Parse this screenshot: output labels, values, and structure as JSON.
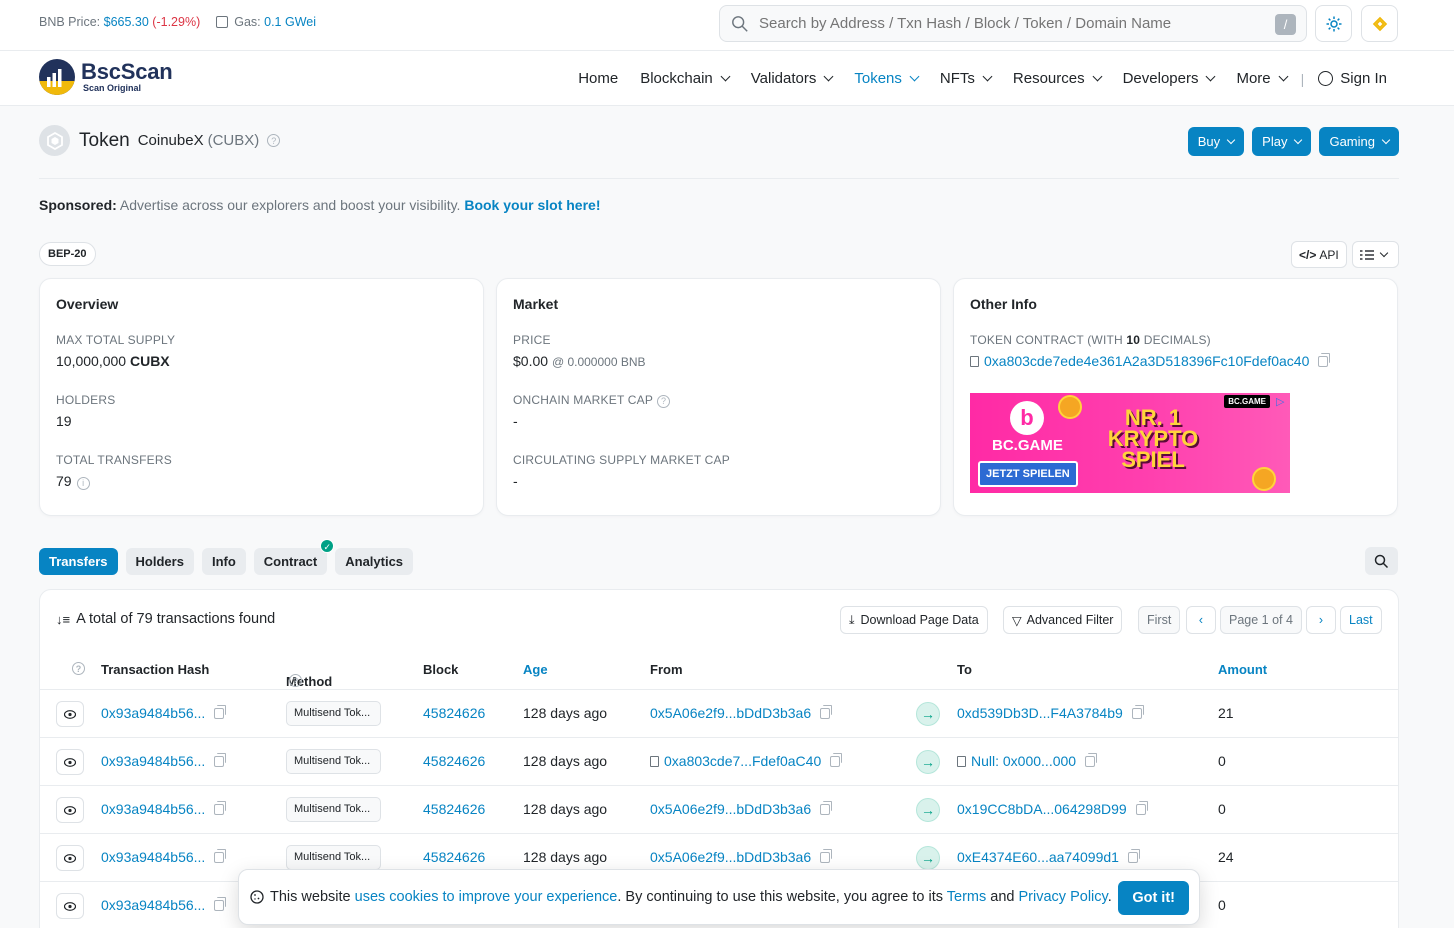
{
  "topbar": {
    "bnb_label": "BNB Price:",
    "bnb_price": "$665.30",
    "bnb_change": "(-1.29%)",
    "gas_label": "Gas:",
    "gas_value": "0.1 GWei",
    "search_placeholder": "Search by Address / Txn Hash / Block / Token / Domain Name",
    "search_shortcut": "/"
  },
  "nav": {
    "brand": "BscScan",
    "tagline": "Scan Original",
    "items": [
      "Home",
      "Blockchain",
      "Validators",
      "Tokens",
      "NFTs",
      "Resources",
      "Developers",
      "More"
    ],
    "separator": "|",
    "signin": "Sign In"
  },
  "token": {
    "label": "Token",
    "name": "CoinubeX",
    "symbol": "(CUBX)",
    "buttons": [
      "Buy",
      "Play",
      "Gaming"
    ]
  },
  "sponsor": {
    "label": "Sponsored:",
    "text": " Advertise across our explorers and boost your visibility. ",
    "link": "Book your slot here!"
  },
  "standard": "BEP-20",
  "api_label": "API",
  "overview": {
    "title": "Overview",
    "max_supply_label": "MAX TOTAL SUPPLY",
    "max_supply_value": "10,000,000",
    "max_supply_unit": "CUBX",
    "holders_label": "HOLDERS",
    "holders_value": "19",
    "transfers_label": "TOTAL TRANSFERS",
    "transfers_value": "79"
  },
  "market": {
    "title": "Market",
    "price_label": "PRICE",
    "price_value": "$0.00",
    "price_bnb": "@ 0.000000 BNB",
    "onchain_label": "ONCHAIN MARKET CAP",
    "onchain_value": "-",
    "circ_label": "CIRCULATING SUPPLY MARKET CAP",
    "circ_value": "-"
  },
  "other": {
    "title": "Other Info",
    "contract_label_pre": "TOKEN CONTRACT (WITH ",
    "contract_decimals": "10",
    "contract_label_post": " DECIMALS)",
    "contract_address": "0xa803cde7ede4e361A2a3D518396Fc10Fdef0ac40",
    "ad": {
      "brand": "BC.GAME",
      "corner": "BC.GAME",
      "cta": "JETZT SPIELEN",
      "headline_1": "NR. 1",
      "headline_2": "KRYPTO",
      "headline_3": "SPIEL"
    }
  },
  "tabs": [
    "Transfers",
    "Holders",
    "Info",
    "Contract",
    "Analytics"
  ],
  "table": {
    "total_text": "A total of 79 transactions found",
    "download": "Download Page Data",
    "advanced": "Advanced Filter",
    "first": "First",
    "page": "Page 1 of 4",
    "last": "Last",
    "headers": {
      "hash": "Transaction Hash",
      "method": "Method",
      "block": "Block",
      "age": "Age",
      "from": "From",
      "to": "To",
      "amount": "Amount"
    },
    "rows": [
      {
        "hash": "0x93a9484b56...",
        "method": "Multisend Tok...",
        "block": "45824626",
        "age": "128 days ago",
        "from": "0x5A06e2f9...bDdD3b3a6",
        "to": "0xd539Db3D...F4A3784b9",
        "amount": "21"
      },
      {
        "hash": "0x93a9484b56...",
        "method": "Multisend Tok...",
        "block": "45824626",
        "age": "128 days ago",
        "from": "0xa803cde7...Fdef0aC40",
        "to": "Null: 0x000...000",
        "amount": "0"
      },
      {
        "hash": "0x93a9484b56...",
        "method": "Multisend Tok...",
        "block": "45824626",
        "age": "128 days ago",
        "from": "0x5A06e2f9...bDdD3b3a6",
        "to": "0x19CC8bDA...064298D99",
        "amount": "0"
      },
      {
        "hash": "0x93a9484b56...",
        "method": "Multisend Tok...",
        "block": "45824626",
        "age": "128 days ago",
        "from": "0x5A06e2f9...bDdD3b3a6",
        "to": "0xE4374E60...aa74099d1",
        "amount": "24"
      },
      {
        "hash": "0x93a9484b56...",
        "method": "",
        "block": "",
        "age": "",
        "from": "",
        "to": "",
        "amount": "0"
      }
    ]
  },
  "cookie": {
    "pre": "This website ",
    "link1": "uses cookies to improve your experience",
    "mid": ". By continuing to use this website, you agree to its ",
    "terms": "Terms",
    "and": " and ",
    "privacy": "Privacy Policy",
    "end": ".",
    "button": "Got it!"
  },
  "colors": {
    "accent": "#0784c3",
    "negative": "#dc3545",
    "success": "#00a186",
    "brand_dark": "#21325b",
    "bnb_yellow": "#f0b90b"
  }
}
